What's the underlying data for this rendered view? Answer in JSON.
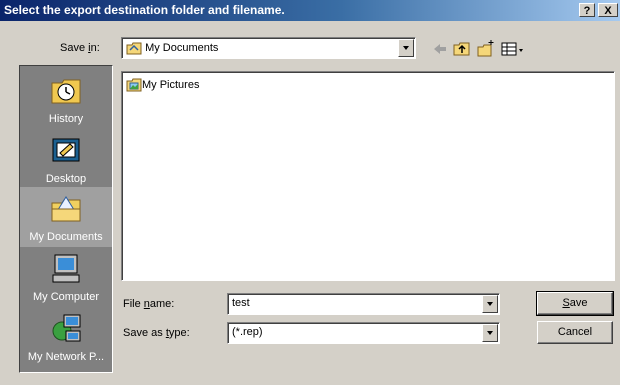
{
  "window": {
    "title": "Select the export destination folder and filename.",
    "help_button": "?",
    "close_button": "X"
  },
  "save_in": {
    "label_before": "Save ",
    "label_accel": "i",
    "label_after": "n:",
    "value": "My Documents"
  },
  "toolbar": {
    "icons": [
      "back-arrow-icon",
      "up-one-level-icon",
      "new-folder-icon",
      "view-menu-icon"
    ]
  },
  "places": [
    {
      "label": "History",
      "icon": "history-icon",
      "selected": false
    },
    {
      "label": "Desktop",
      "icon": "desktop-icon",
      "selected": false
    },
    {
      "label": "My Documents",
      "icon": "my-documents-icon",
      "selected": true
    },
    {
      "label": "My Computer",
      "icon": "my-computer-icon",
      "selected": false
    },
    {
      "label": "My Network P...",
      "icon": "network-places-icon",
      "selected": false
    }
  ],
  "files": [
    {
      "name": "My Pictures",
      "icon": "folder-pictures-icon"
    }
  ],
  "file_name": {
    "label_before": "File ",
    "label_accel": "n",
    "label_after": "ame:",
    "value": "test"
  },
  "save_as_type": {
    "label_before": "Save as ",
    "label_accel": "t",
    "label_after": "ype:",
    "value": "(*.rep)"
  },
  "buttons": {
    "save_accel": "S",
    "save_rest": "ave",
    "cancel": "Cancel"
  },
  "colors": {
    "titlebar_start": "#0a246a",
    "titlebar_end": "#a6caf0",
    "face": "#d4d0c8",
    "places_bg": "#808080"
  }
}
